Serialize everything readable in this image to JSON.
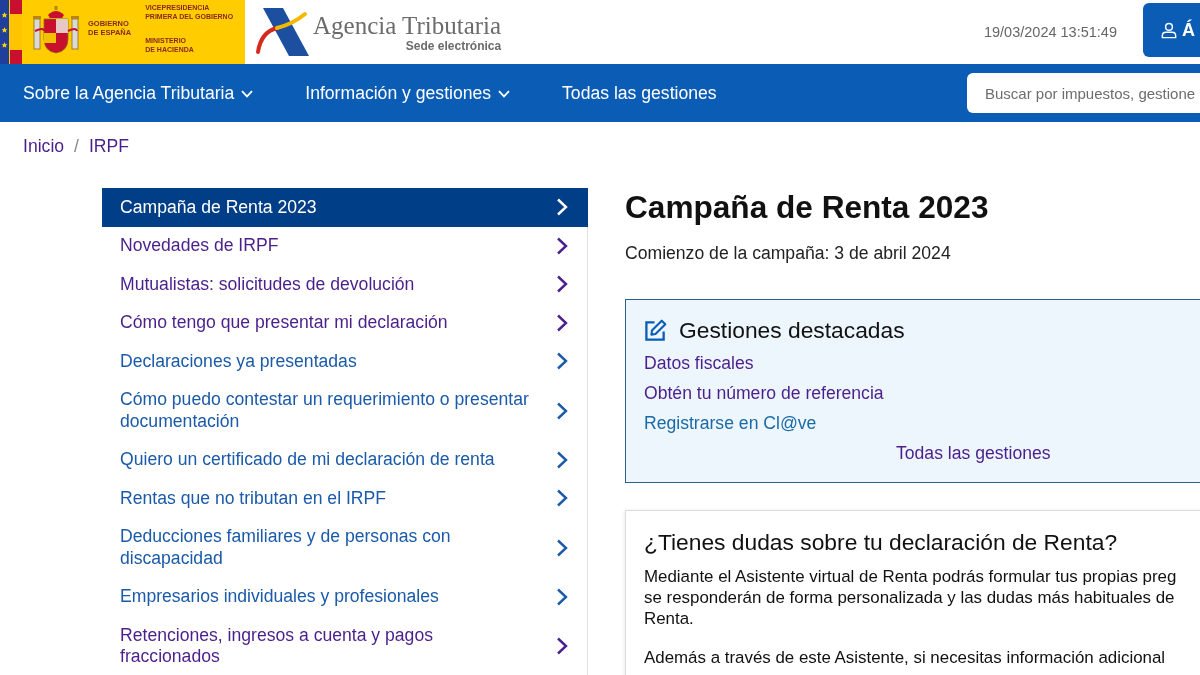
{
  "header": {
    "government_logo": {
      "name_lines": [
        "GOBIERNO",
        "DE ESPAÑA"
      ],
      "departments": [
        {
          "lines": [
            "VICEPRESIDENCIA",
            "PRIMERA DEL GOBIERNO"
          ]
        },
        {
          "lines": [
            "MINISTERIO",
            "DE HACIENDA"
          ]
        }
      ]
    },
    "agency_logo": {
      "name": "Agencia Tributaria",
      "subtitle": "Sede electrónica"
    },
    "datetime": "19/03/2024 13:51:49",
    "account_button": {
      "label": "Á"
    }
  },
  "nav": {
    "items": [
      {
        "label": "Sobre la Agencia Tributaria",
        "has_menu": true
      },
      {
        "label": "Información y gestiones",
        "has_menu": true
      },
      {
        "label": "Todas las gestiones",
        "has_menu": false
      }
    ],
    "search": {
      "placeholder": "Buscar por impuestos, gestione"
    }
  },
  "breadcrumb": {
    "items": [
      {
        "label": "Inicio"
      },
      {
        "label": "IRPF"
      }
    ],
    "separator": "/"
  },
  "sidebar": {
    "items": [
      {
        "label": "Campaña de Renta 2023",
        "selected": true
      },
      {
        "label": "Novedades de IRPF",
        "selected": false,
        "visited": true
      },
      {
        "label": "Mutualistas: solicitudes de devolución",
        "selected": false,
        "visited": true
      },
      {
        "label": "Cómo tengo que presentar mi declaración",
        "selected": false,
        "visited": true
      },
      {
        "label": "Declaraciones ya presentadas",
        "selected": false,
        "visited": false
      },
      {
        "label": "Cómo puedo contestar un requerimiento o presentar documentación",
        "selected": false,
        "visited": false
      },
      {
        "label": "Quiero un certificado de mi declaración de renta",
        "selected": false,
        "visited": false
      },
      {
        "label": "Rentas que no tributan en el IRPF",
        "selected": false,
        "visited": false
      },
      {
        "label": "Deducciones familiares y de personas con discapacidad",
        "selected": false,
        "visited": false
      },
      {
        "label": "Empresarios individuales y profesionales",
        "selected": false,
        "visited": false
      },
      {
        "label": "Retenciones, ingresos a cuenta y pagos fraccionados",
        "selected": false,
        "visited": true
      }
    ]
  },
  "main": {
    "title": "Campaña de Renta 2023",
    "subtitle": "Comienzo de la campaña: 3 de abril 2024",
    "featured": {
      "title": "Gestiones destacadas",
      "links": [
        {
          "label": "Datos fiscales",
          "visited": true
        },
        {
          "label": "Obtén tu número de referencia",
          "visited": true
        },
        {
          "label": "Registrarse en Cl@ve",
          "visited": false
        }
      ],
      "all_link": {
        "label": "Todas las gestiones",
        "visited": true
      }
    },
    "help": {
      "title": "¿Tienes dudas sobre tu declaración de Renta?",
      "paragraphs": [
        {
          "lines": [
            "Mediante el Asistente virtual de Renta podrás formular tus propias preg",
            "se responderán de forma personalizada y las dudas más habituales de",
            "Renta."
          ]
        },
        {
          "lines": [
            "Además a través de este Asistente, si necesitas información adicional"
          ]
        }
      ]
    }
  }
}
